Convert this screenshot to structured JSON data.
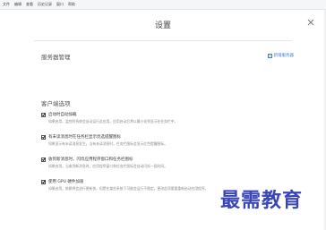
{
  "menubar": {
    "items": [
      {
        "label": "文件"
      },
      {
        "label": "编辑"
      },
      {
        "label": "查看"
      },
      {
        "label": "历史记录"
      },
      {
        "label": "窗口"
      },
      {
        "label": "帮助"
      }
    ]
  },
  "dialog": {
    "title": "设置"
  },
  "server": {
    "section_title": "服务器管理",
    "add_label": "新增服务器"
  },
  "client": {
    "section_title": "客户端选项",
    "options": [
      {
        "label": "启动时自动加载",
        "desc": "如果启用，监控时系统会自动运行此应用。应用启动后将以最小化到显示在任务栏中。",
        "checked": true
      },
      {
        "label": "有未读消息时在任务栏显示优选提醒图标",
        "desc": "如果显示有未读消息发生，当有未读消息时，任务栏图标会显示红色提醒图标。",
        "checked": true
      },
      {
        "label": "收到新消息时，闪烁应用程序窗口和任务栏图标",
        "desc": "如果启用，当收到新消息时，应用程序窗口和任务栏图标会自动闪烁一段时间。",
        "checked": true
      },
      {
        "label": "使用 GPU 硬件加速",
        "desc": "如果启用，依赖将会进行更新快，但是在某些系统下可能会运行不稳定。更改此项需要重新启动应用程序。",
        "checked": true
      }
    ]
  },
  "watermark": {
    "text": "最需教育"
  },
  "colors": {
    "accent": "#3b7fd0",
    "watermark": "#2f3db3"
  }
}
